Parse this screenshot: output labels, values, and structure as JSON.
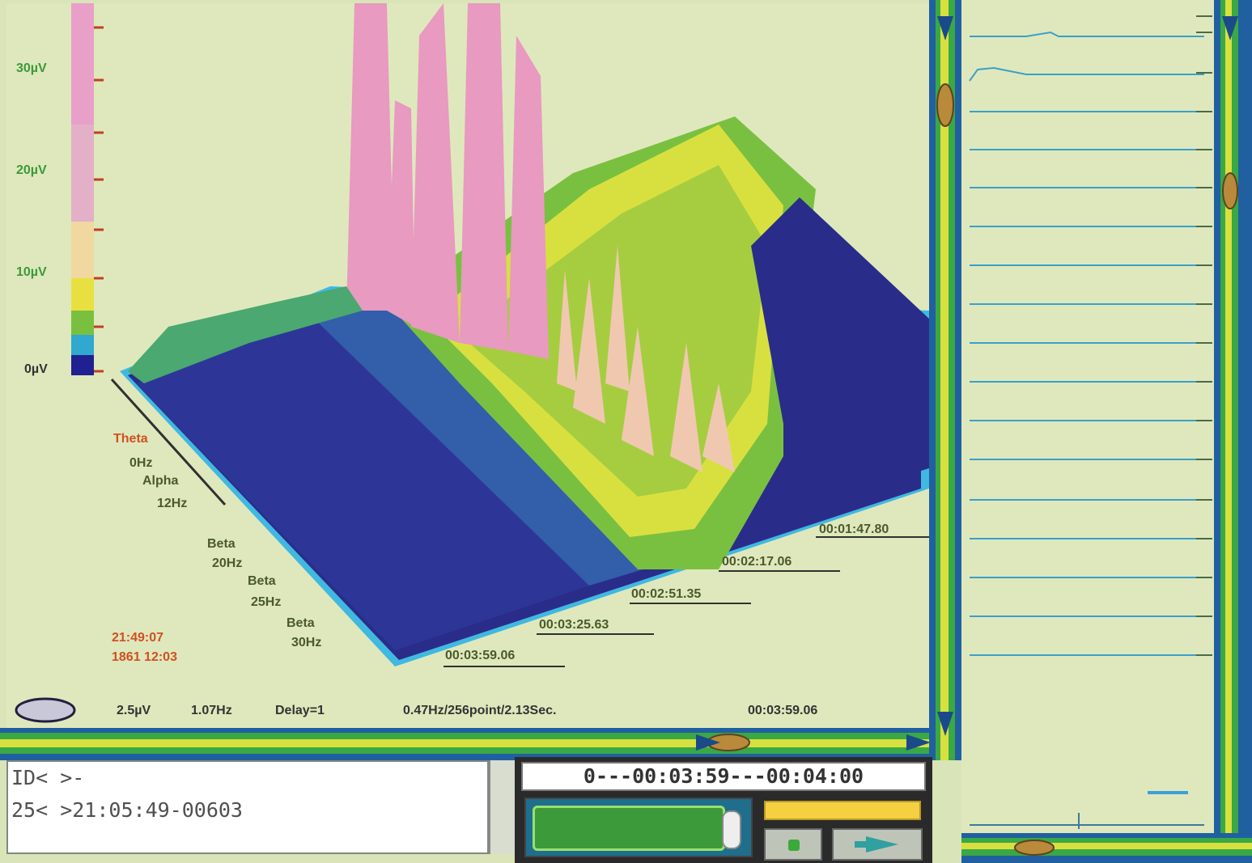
{
  "axis": {
    "y_labels": [
      "30µV",
      "20µV",
      "10µV",
      "0µV"
    ],
    "freq_labels": [
      "Theta",
      "0Hz",
      "Alpha",
      "12Hz",
      "Beta",
      "20Hz",
      "Beta",
      "25Hz",
      "Beta",
      "30Hz"
    ],
    "time_labels": [
      "00:01:47.80",
      "00:02:17.06",
      "00:02:51.35",
      "00:03:25.63",
      "00:03:59.06"
    ]
  },
  "annotation": {
    "line1": "21:49:07",
    "line2": "1861 12:03"
  },
  "status_bar": {
    "scale": "2.5µV",
    "freq": "1.07Hz",
    "delay": "Delay=1",
    "resolution": "0.47Hz/256point/2.13Sec.",
    "timestamp": "00:03:59.06"
  },
  "info": {
    "line1": "ID< >-",
    "line2": "25< >21:05:49-00603"
  },
  "player": {
    "time_range": "0---00:03:59---00:04:00",
    "progress": 0.85
  },
  "colors": {
    "background": "#dfe8bd",
    "frame_green": "#3aa844",
    "frame_blue": "#2060a0",
    "accent_yellow": "#f5d040",
    "spectrum_pink": "#e8a0c8"
  }
}
